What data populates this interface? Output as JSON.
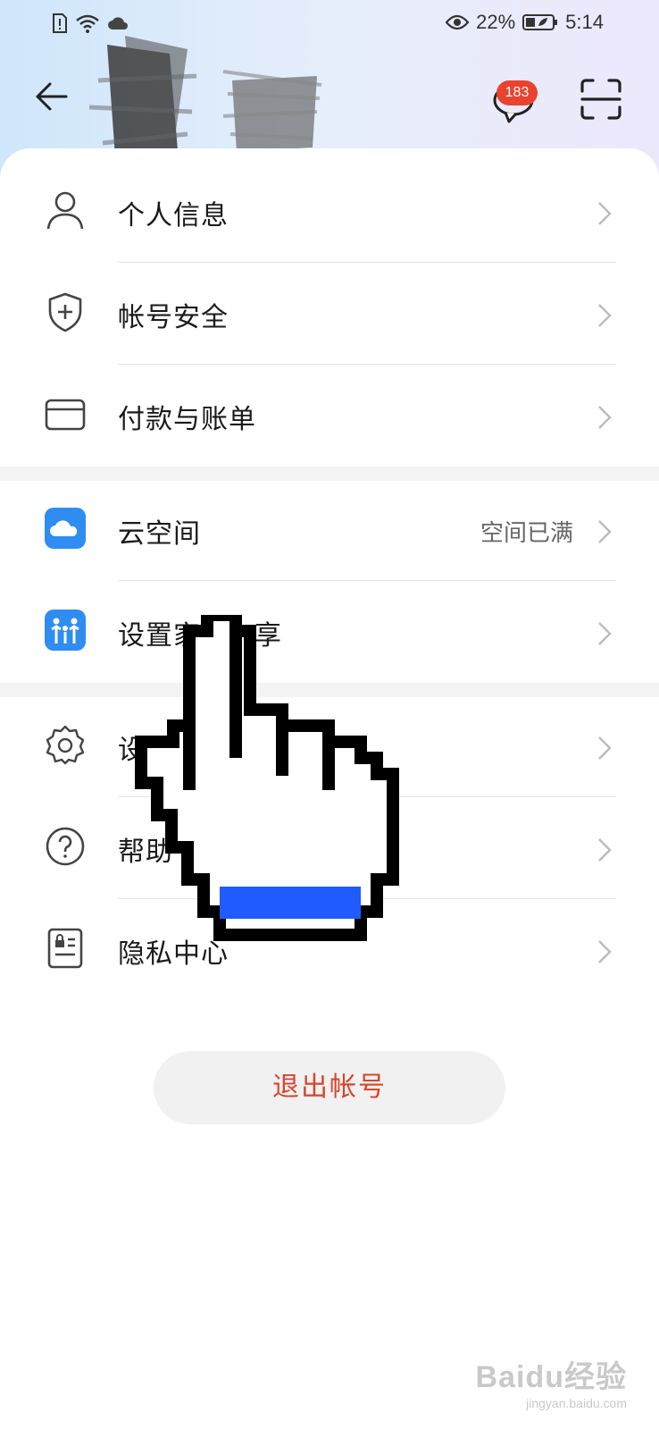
{
  "status_bar": {
    "battery": "22%",
    "time": "5:14"
  },
  "header": {
    "message_badge": "183"
  },
  "menu": {
    "group1": [
      {
        "label": "个人信息",
        "icon": "person-icon"
      },
      {
        "label": "帐号安全",
        "icon": "shield-plus-icon"
      },
      {
        "label": "付款与账单",
        "icon": "card-icon"
      }
    ],
    "group2": [
      {
        "label": "云空间",
        "icon": "cloud-icon",
        "value": "空间已满"
      },
      {
        "label": "设置家",
        "label_tail": "享",
        "icon": "family-icon"
      }
    ],
    "group3": [
      {
        "label": "设",
        "icon": "gear-icon"
      },
      {
        "label": "帮助",
        "icon": "help-icon"
      },
      {
        "label": "隐私中心",
        "icon": "privacy-icon"
      }
    ]
  },
  "logout_label": "退出帐号",
  "watermark": {
    "logo": "Baidu经验",
    "url": "jingyan.baidu.com"
  },
  "colors": {
    "accent_red": "#d9452b",
    "badge_red": "#e8432f",
    "cloud_blue": "#2f8cf0",
    "cursor_blue": "#1f5bff"
  }
}
